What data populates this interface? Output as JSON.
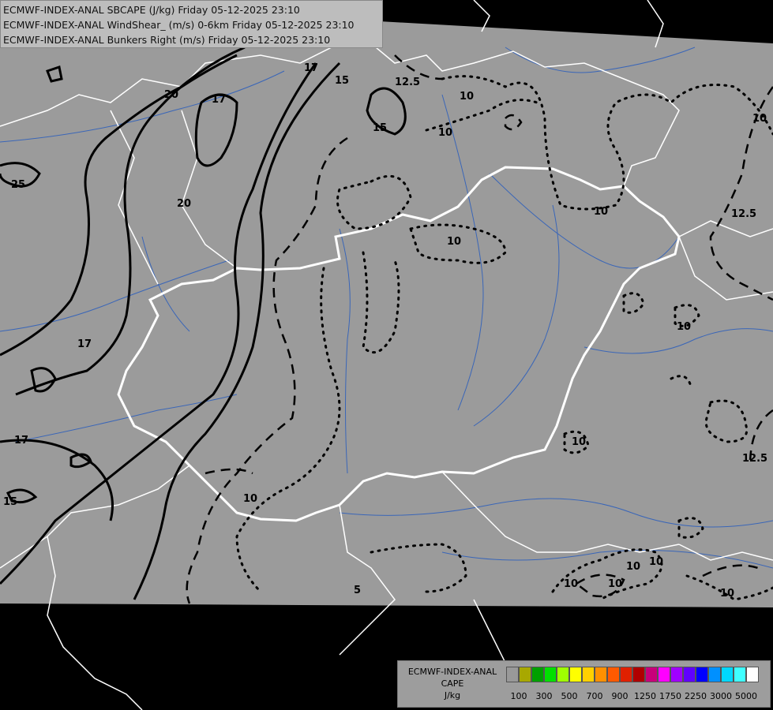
{
  "title_lines": [
    "ECMWF-INDEX-ANAL SBCAPE (J/kg) Friday 05-12-2025 23:10",
    "ECMWF-INDEX-ANAL WindShear_ (m/s) 0-6km Friday 05-12-2025 23:10",
    "ECMWF-INDEX-ANAL Bunkers Right (m/s) Friday 05-12-2025 23:10"
  ],
  "legend": {
    "name_lines": [
      "ECMWF-INDEX-ANAL",
      "CAPE",
      "J/kg"
    ],
    "swatch_colors": [
      "#999999",
      "#a8a800",
      "#00a000",
      "#00e000",
      "#a0ff00",
      "#ffff00",
      "#ffd000",
      "#ff9000",
      "#ff5a00",
      "#e02000",
      "#b00000",
      "#c8007a",
      "#ff00ff",
      "#a000ff",
      "#6000ff",
      "#0000ff",
      "#0090ff",
      "#00d8ff",
      "#40ffff",
      "#ffffff"
    ],
    "tick_labels": [
      "100",
      "300",
      "500",
      "700",
      "900",
      "1250",
      "1750",
      "2250",
      "3000",
      "5000"
    ]
  },
  "contour_labels": [
    "20",
    "17",
    "17",
    "15",
    "12.5",
    "15",
    "10",
    "10",
    "10",
    "10",
    "10",
    "12.5",
    "10",
    "25",
    "20",
    "17",
    "17",
    "15",
    "10",
    "12.5",
    "10",
    "10",
    "10",
    "10",
    "5",
    "10",
    "10"
  ],
  "colors": {
    "domain_fill": "#9b9b9b",
    "outside": "#000000",
    "border": "#ffffff",
    "river": "#3a66b8",
    "contour": "#000000"
  }
}
